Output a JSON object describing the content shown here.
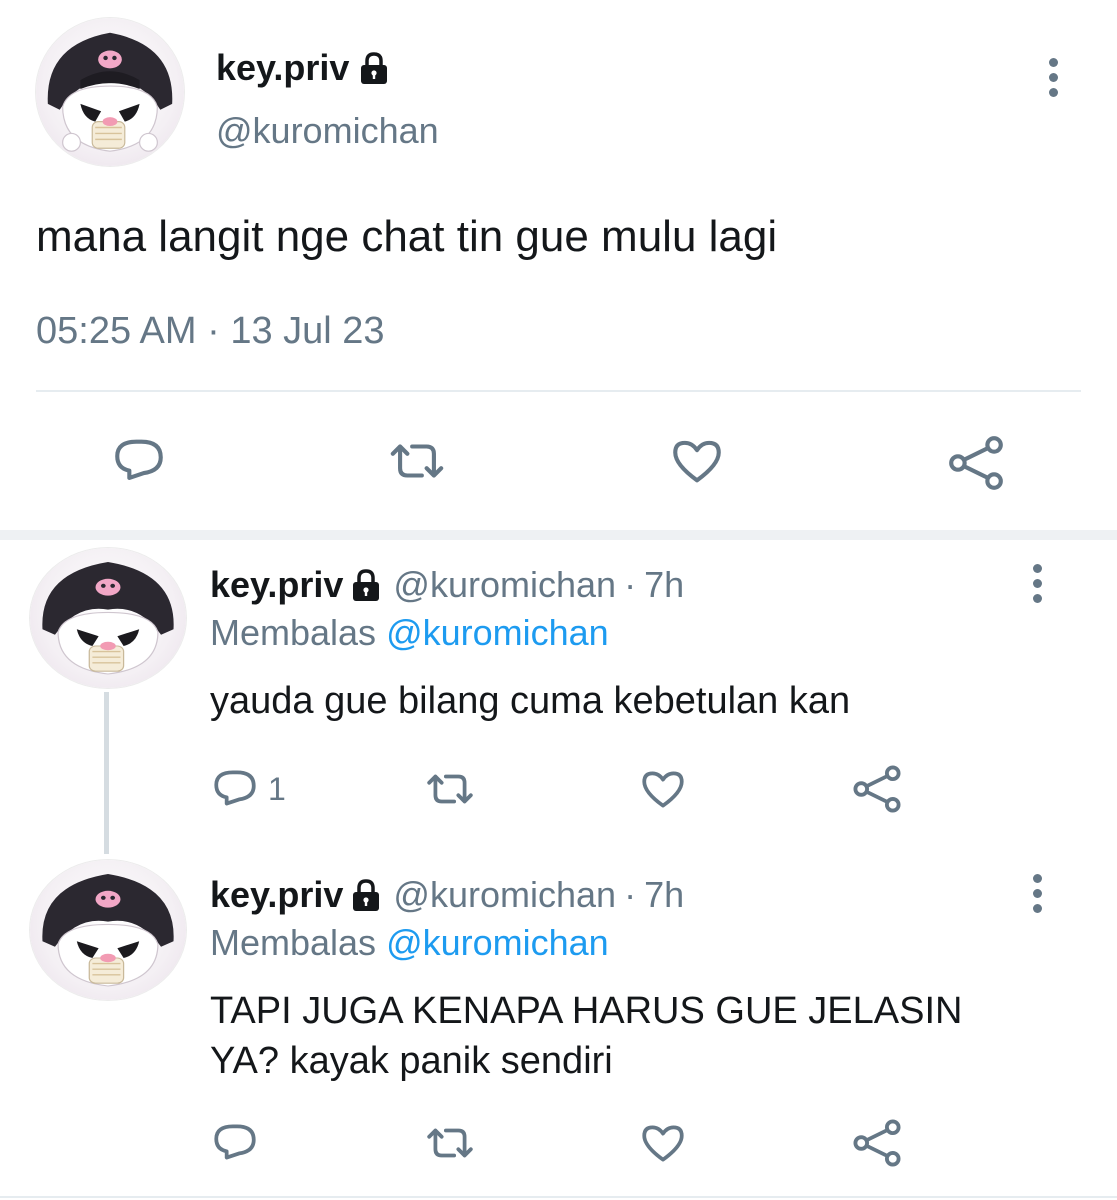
{
  "main_tweet": {
    "display_name": "key.priv",
    "handle": "@kuromichan",
    "text": "mana langit nge chat tin gue mulu lagi",
    "timestamp": "05:25 AM · 13 Jul 23",
    "protected_icon": "lock-icon",
    "actions": [
      "reply-icon",
      "retweet-icon",
      "like-icon",
      "share-icon"
    ]
  },
  "replies": [
    {
      "display_name": "key.priv",
      "handle": "@kuromichan",
      "separator": "·",
      "time": "7h",
      "replying_prefix": "Membalas",
      "replying_to": "@kuromichan",
      "text": "yauda gue bilang cuma kebetulan kan",
      "reply_count": "1"
    },
    {
      "display_name": "key.priv",
      "handle": "@kuromichan",
      "separator": "·",
      "time": "7h",
      "replying_prefix": "Membalas",
      "replying_to": "@kuromichan",
      "text_line1": "TAPI JUGA KENAPA HARUS GUE JELASIN",
      "text_line2": "YA? kayak panik sendiri",
      "reply_count": ""
    }
  ],
  "colors": {
    "text": "#14171a",
    "muted": "#657786",
    "link": "#1d9bf0",
    "divider": "#e6ecf0",
    "section_gap": "#e6ecf0"
  }
}
